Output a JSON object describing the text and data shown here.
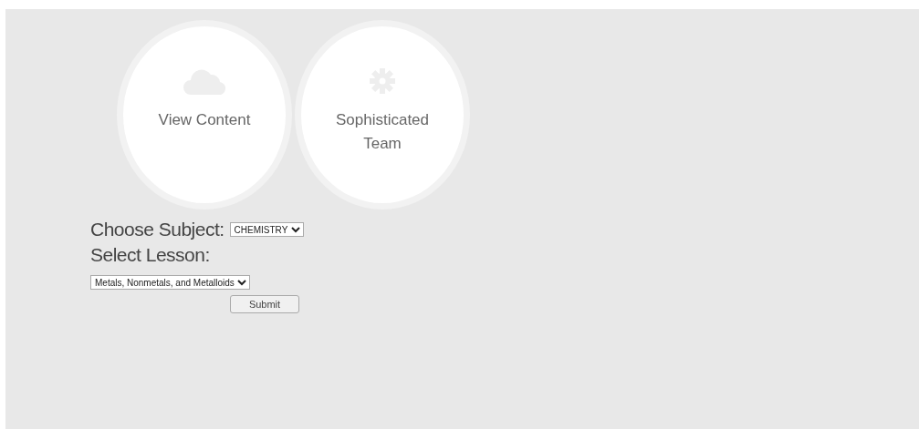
{
  "tiles": [
    {
      "label": "View Content",
      "kind": "cloud"
    },
    {
      "label": "Sophisticated Team",
      "kind": "gear"
    }
  ],
  "form": {
    "subject_label": "Choose Subject:",
    "subject_value": "CHEMISTRY",
    "lesson_label": "Select Lesson:",
    "lesson_value": "Metals, Nonmetals, and Metalloids",
    "submit": "Submit"
  }
}
